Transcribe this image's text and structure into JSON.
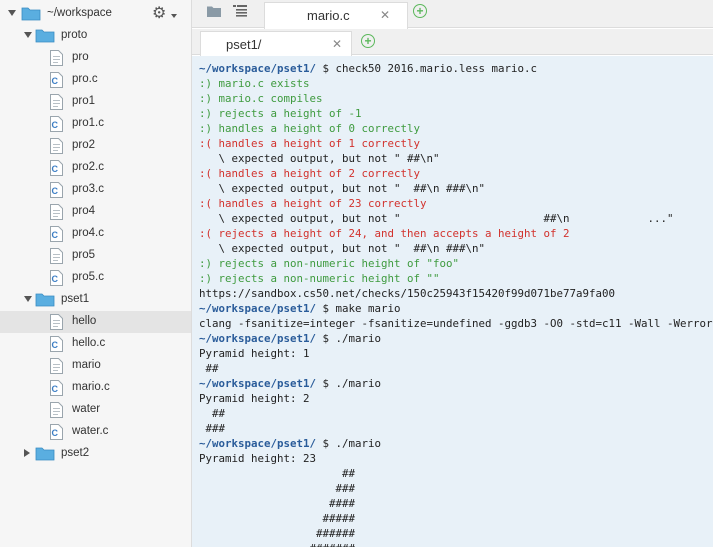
{
  "colors": {
    "green": "#3f9b3f",
    "red": "#d2322d",
    "path": "#2a5c9a",
    "folder": "#5aaee0"
  },
  "tree": {
    "root_label": "~/workspace",
    "items": [
      {
        "label": "proto",
        "type": "folder",
        "depth": 1,
        "expanded": true
      },
      {
        "label": "pro",
        "type": "file",
        "depth": 2
      },
      {
        "label": "pro.c",
        "type": "cfile",
        "depth": 2
      },
      {
        "label": "pro1",
        "type": "file",
        "depth": 2
      },
      {
        "label": "pro1.c",
        "type": "cfile",
        "depth": 2
      },
      {
        "label": "pro2",
        "type": "file",
        "depth": 2
      },
      {
        "label": "pro2.c",
        "type": "cfile",
        "depth": 2
      },
      {
        "label": "pro3.c",
        "type": "cfile",
        "depth": 2
      },
      {
        "label": "pro4",
        "type": "file",
        "depth": 2
      },
      {
        "label": "pro4.c",
        "type": "cfile",
        "depth": 2
      },
      {
        "label": "pro5",
        "type": "file",
        "depth": 2
      },
      {
        "label": "pro5.c",
        "type": "cfile",
        "depth": 2
      },
      {
        "label": "pset1",
        "type": "folder",
        "depth": 1,
        "expanded": true
      },
      {
        "label": "hello",
        "type": "file",
        "depth": 2,
        "selected": true
      },
      {
        "label": "hello.c",
        "type": "cfile",
        "depth": 2
      },
      {
        "label": "mario",
        "type": "file",
        "depth": 2
      },
      {
        "label": "mario.c",
        "type": "cfile",
        "depth": 2
      },
      {
        "label": "water",
        "type": "file",
        "depth": 2
      },
      {
        "label": "water.c",
        "type": "cfile",
        "depth": 2
      },
      {
        "label": "pset2",
        "type": "folder",
        "depth": 1,
        "expanded": false
      }
    ]
  },
  "editor_tabs": [
    {
      "label": "mario.c",
      "close": "✕"
    }
  ],
  "terminal_tabs": [
    {
      "label": "pset1/",
      "close": "✕"
    }
  ],
  "terminal": {
    "lines": [
      {
        "path": "~/workspace/pset1/",
        "text": " $ check50 2016.mario.less mario.c"
      },
      {
        "color": "green",
        "text": ":) mario.c exists"
      },
      {
        "color": "green",
        "text": ":) mario.c compiles"
      },
      {
        "color": "green",
        "text": ":) rejects a height of -1"
      },
      {
        "color": "green",
        "text": ":) handles a height of 0 correctly"
      },
      {
        "color": "red",
        "text": ":( handles a height of 1 correctly"
      },
      {
        "text": "   \\ expected output, but not \" ##\\n\""
      },
      {
        "color": "red",
        "text": ":( handles a height of 2 correctly"
      },
      {
        "text": "   \\ expected output, but not \"  ##\\n ###\\n\""
      },
      {
        "color": "red",
        "text": ":( handles a height of 23 correctly"
      },
      {
        "text": "   \\ expected output, but not \"                      ##\\n            ...\""
      },
      {
        "color": "red",
        "text": ":( rejects a height of 24, and then accepts a height of 2"
      },
      {
        "text": "   \\ expected output, but not \"  ##\\n ###\\n\""
      },
      {
        "color": "green",
        "text": ":) rejects a non-numeric height of \"foo\""
      },
      {
        "color": "green",
        "text": ":) rejects a non-numeric height of \"\""
      },
      {
        "text": "https://sandbox.cs50.net/checks/150c25943f15420f99d071be77a9fa00"
      },
      {
        "path": "~/workspace/pset1/",
        "text": " $ make mario"
      },
      {
        "text": "clang -fsanitize=integer -fsanitize=undefined -ggdb3 -O0 -std=c11 -Wall -Werror"
      },
      {
        "path": "~/workspace/pset1/",
        "text": " $ ./mario"
      },
      {
        "text": "Pyramid height: 1"
      },
      {
        "text": " ##"
      },
      {
        "path": "~/workspace/pset1/",
        "text": " $ ./mario"
      },
      {
        "text": "Pyramid height: 2"
      },
      {
        "text": "  ##"
      },
      {
        "text": " ###"
      },
      {
        "path": "~/workspace/pset1/",
        "text": " $ ./mario"
      },
      {
        "text": "Pyramid height: 23"
      },
      {
        "text": "                      ##"
      },
      {
        "text": "                     ###"
      },
      {
        "text": "                    ####"
      },
      {
        "text": "                   #####"
      },
      {
        "text": "                  ######"
      },
      {
        "text": "                 #######"
      }
    ]
  }
}
